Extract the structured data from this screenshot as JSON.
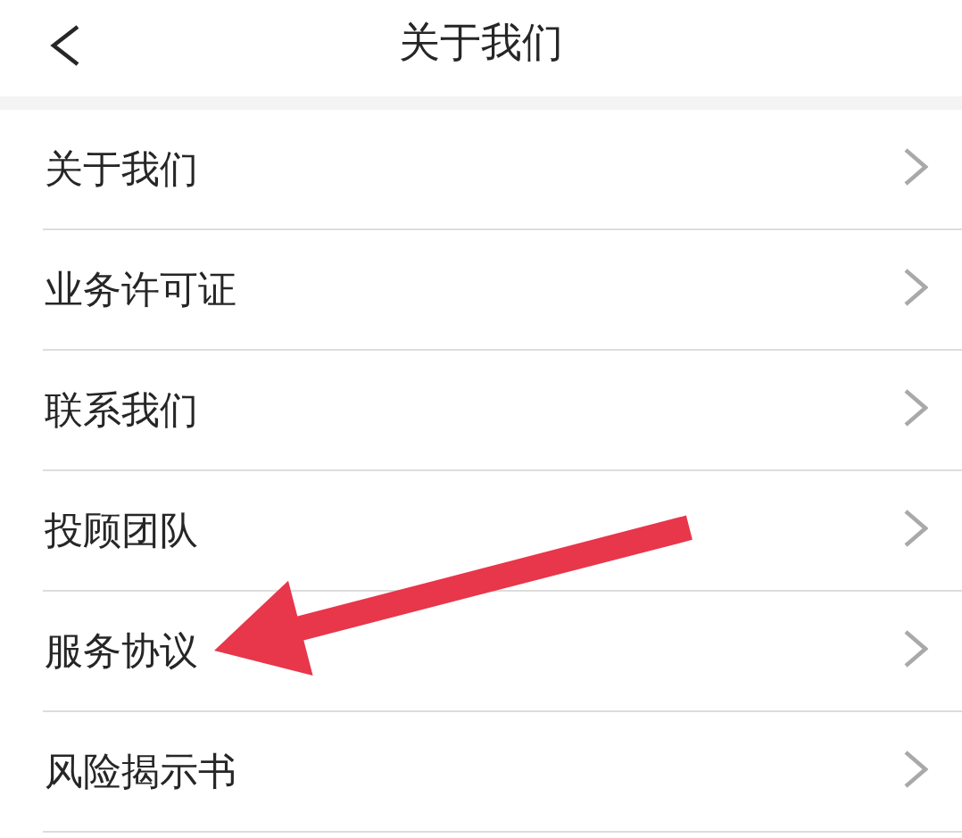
{
  "header": {
    "title": "关于我们"
  },
  "menu": [
    {
      "label": "关于我们",
      "annotated": false
    },
    {
      "label": "业务许可证",
      "annotated": false
    },
    {
      "label": "联系我们",
      "annotated": false
    },
    {
      "label": "投顾团队",
      "annotated": false
    },
    {
      "label": "服务协议",
      "annotated": true
    },
    {
      "label": "风险揭示书",
      "annotated": false
    }
  ]
}
